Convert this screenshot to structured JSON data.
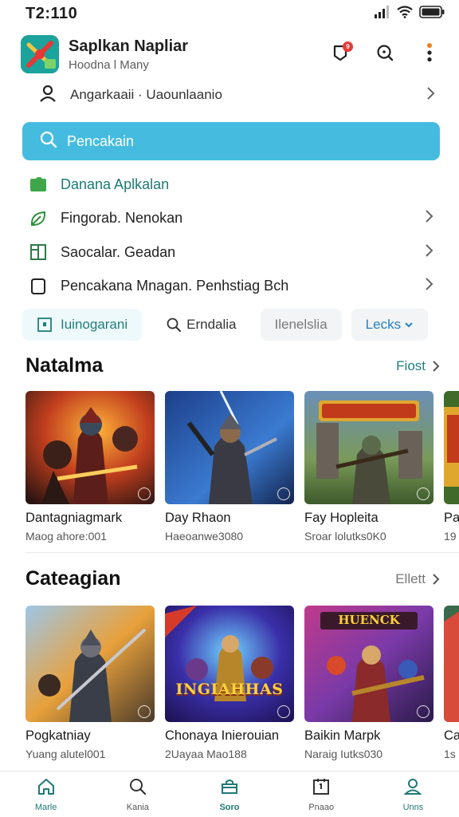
{
  "status_bar": {
    "time": "T2:110"
  },
  "header": {
    "app_title": "Saplkan Napliar",
    "app_subtitle": "Hoodna l Many",
    "notification_count": "9"
  },
  "account": {
    "label": "Angarkaaii · Uaounlaanio"
  },
  "search": {
    "placeholder": "Pencakain"
  },
  "menu": {
    "items": [
      {
        "label": "Danana Aplkalan",
        "icon": "folder-icon",
        "highlight": true
      },
      {
        "label": "Fingorab. Nenokan",
        "icon": "leaf-icon"
      },
      {
        "label": "Saocalar. Geadan",
        "icon": "book-icon"
      },
      {
        "label": "Pencakana Mnagan. Penhstiag Bch",
        "icon": "chat-icon"
      }
    ]
  },
  "chips": [
    {
      "label": "Iuinogarani"
    },
    {
      "label": "Erndalia"
    },
    {
      "label": "Ilenelslia"
    },
    {
      "label": "Lecks"
    }
  ],
  "section1": {
    "title": "Natalma",
    "link": "Fiost",
    "cards": [
      {
        "title": "Dantagniagmark",
        "subtitle": "Maog ahore:001"
      },
      {
        "title": "Day Rhaon",
        "subtitle": "Haeoanwe3080"
      },
      {
        "title": "Fay Hopleita",
        "subtitle": "Sroar lolutks0K0"
      },
      {
        "title": "Pa",
        "subtitle": "19"
      }
    ]
  },
  "section2": {
    "title": "Cateagian",
    "link": "Ellett",
    "cards": [
      {
        "title": "Pogkatniay",
        "subtitle": "Yuang alutel001",
        "thumb_text": ""
      },
      {
        "title": "Chonaya Inierouian",
        "subtitle": "2Uayaa Mao188",
        "thumb_text": "INGIAHHAS"
      },
      {
        "title": "Baikin Marpk",
        "subtitle": "Naraig Iutks030",
        "thumb_text": "HUENCK"
      },
      {
        "title": "Ca",
        "subtitle": "1s"
      }
    ]
  },
  "bottom_nav": [
    {
      "label": "Marle",
      "icon": "home-icon"
    },
    {
      "label": "Kania",
      "icon": "search-icon"
    },
    {
      "label": "Soro",
      "icon": "store-icon"
    },
    {
      "label": "Pnaao",
      "icon": "library-icon"
    },
    {
      "label": "Unns",
      "icon": "profile-icon"
    }
  ],
  "colors": {
    "accent": "#45bcdf",
    "teal": "#1e7a74",
    "link_blue": "#2582c5",
    "badge_red": "#e53935"
  }
}
